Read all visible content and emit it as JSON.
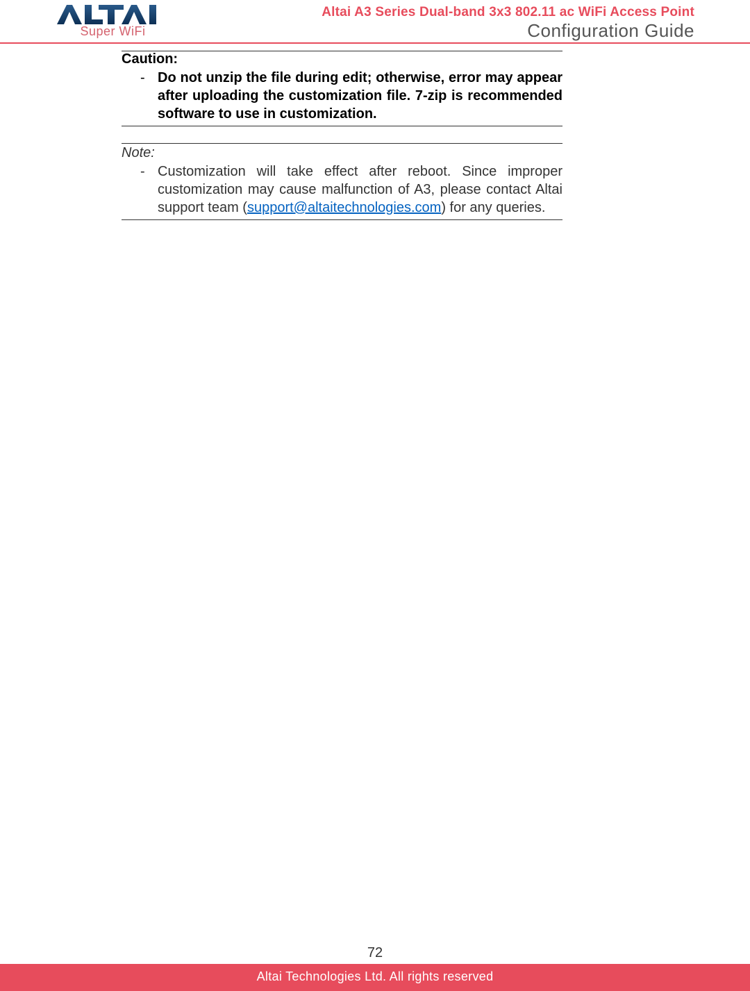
{
  "header": {
    "logo_main": "ALTAI",
    "logo_sub": "Super WiFi",
    "title_1": "Altai A3 Series Dual-band 3x3 802.11 ac WiFi Access Point",
    "title_2": "Configuration Guide"
  },
  "caution": {
    "label": "Caution:",
    "item": "Do not unzip the file during edit; otherwise, error may appear after uploading the customization file. 7-zip is recommended software to use in customization."
  },
  "note": {
    "label": "Note:",
    "item_pre": "Customization will take effect after reboot. Since improper customization may cause malfunction of A3, please contact Altai support team (",
    "email": "support@altaitechnologies.com",
    "item_post": ") for any queries."
  },
  "footer": {
    "page_number": "72",
    "copyright": "Altai Technologies Ltd. All rights reserved"
  }
}
